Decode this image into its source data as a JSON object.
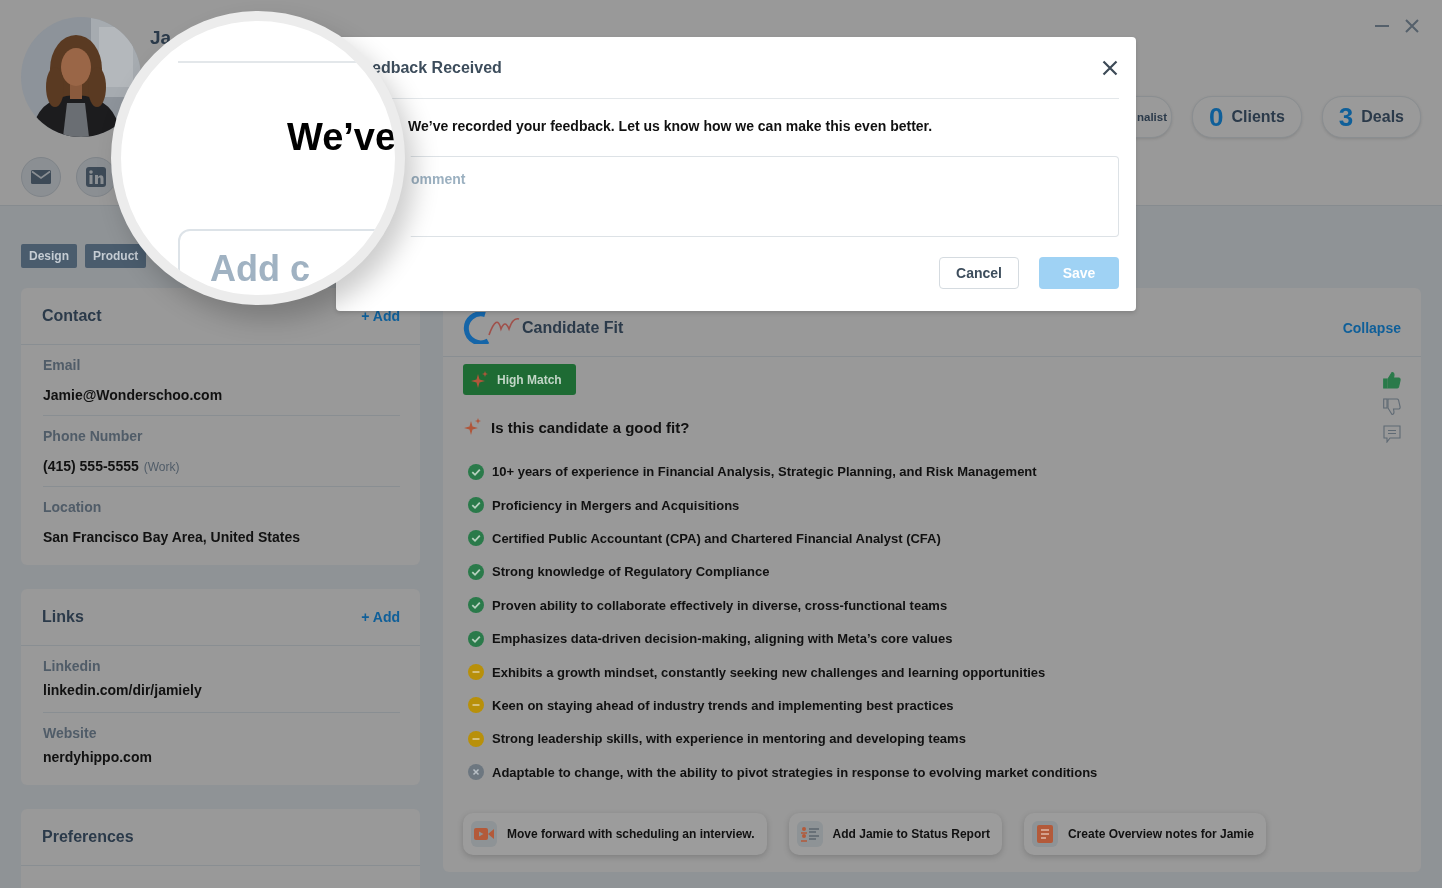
{
  "profile": {
    "name": "Ja",
    "tags": [
      "Design",
      "Product"
    ]
  },
  "stats": [
    {
      "label": "nalist"
    },
    {
      "number": "0",
      "label": "Clients"
    },
    {
      "number": "3",
      "label": "Deals"
    }
  ],
  "contact": {
    "title": "Contact",
    "add": "+ Add",
    "fields": [
      {
        "label": "Email",
        "value": "Jamie@Wonderschoo.com"
      },
      {
        "label": "Phone Number",
        "value": "(415) 555-5555",
        "note": "(Work)"
      },
      {
        "label": "Location",
        "value": "San Francisco Bay Area, United States"
      }
    ]
  },
  "links": {
    "title": "Links",
    "add": "+ Add",
    "fields": [
      {
        "label": "Linkedin",
        "value": "linkedin.com/dir/jamiely"
      },
      {
        "label": "Website",
        "value": "nerdyhippo.com"
      }
    ]
  },
  "preferences": {
    "title": "Preferences"
  },
  "candidate_fit": {
    "title": "Candidate Fit",
    "collapse": "Collapse",
    "badge": "High Match",
    "question": "Is this candidate a good fit?",
    "votes": [
      {
        "kind": "up",
        "selected": true
      },
      {
        "kind": "down",
        "selected": false
      }
    ],
    "criteria": [
      {
        "text": "10+ years of experience in Financial Analysis, Strategic Planning, and Risk Management",
        "kind": "met"
      },
      {
        "text": "Proficiency in Mergers and Acquisitions",
        "kind": "met"
      },
      {
        "text": "Certified Public Accountant (CPA) and Chartered Financial Analyst (CFA)",
        "kind": "met"
      },
      {
        "text": "Strong knowledge of Regulatory Compliance",
        "kind": "met"
      },
      {
        "text": "Proven ability to collaborate effectively in diverse, cross-functional teams",
        "kind": "met"
      },
      {
        "text": "Emphasizes data-driven decision-making, aligning with Meta’s core values",
        "kind": "met"
      },
      {
        "text": "Exhibits a growth mindset, constantly seeking new challenges and learning opportunities",
        "kind": "partial"
      },
      {
        "text": "Keen on staying ahead of industry trends and implementing best practices",
        "kind": "partial"
      },
      {
        "text": "Strong leadership skills, with experience in mentoring and developing teams",
        "kind": "partial"
      },
      {
        "text": "Adaptable to change, with the ability to pivot strategies in response to evolving market conditions",
        "kind": "unmet"
      }
    ],
    "actions": [
      {
        "label": "Move forward with scheduling an interview.",
        "kind": "video"
      },
      {
        "label": "Add Jamie to Status Report",
        "kind": "list"
      },
      {
        "label": "Create Overview notes for Jamie",
        "kind": "notes"
      }
    ]
  },
  "modal": {
    "title": "edback Received",
    "message": "We’ve recorded your feedback. Let us know how we can make this even better.",
    "comment": {
      "placeholder": "omment"
    },
    "buttons": [
      {
        "label": "Cancel",
        "kind": "secondary",
        "disabled": false
      },
      {
        "label": "Save",
        "kind": "primary",
        "disabled": true
      }
    ]
  },
  "magnifier": {
    "heading": "We’ve",
    "placeholder": "Add c"
  }
}
